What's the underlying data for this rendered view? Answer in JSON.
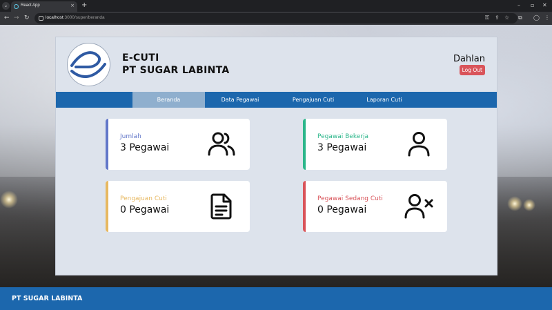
{
  "browser": {
    "tab_title": "React App",
    "url_host": "localhost",
    "url_path": ":3000/super/beranda",
    "menu_glyph": "⌄",
    "tab_close_glyph": "×",
    "new_tab_glyph": "+",
    "minimize_glyph": "–",
    "maximize_glyph": "▫",
    "close_glyph": "✕",
    "back_glyph": "←",
    "forward_glyph": "→",
    "reload_glyph": "↻",
    "key_glyph": "⚿",
    "share_glyph": "⇪",
    "star_glyph": "☆",
    "extensions_glyph": "⧉",
    "profile_glyph": "◯",
    "more_glyph": "⋮"
  },
  "header": {
    "brand_line_1": "E-CUTI",
    "brand_line_2": "PT SUGAR LABINTA",
    "user_name": "Dahlan",
    "logout_label": "Log Out"
  },
  "nav": {
    "items": [
      {
        "label": "Beranda"
      },
      {
        "label": "Data Pegawai"
      },
      {
        "label": "Pengajuan Cuti"
      },
      {
        "label": "Laporan Cuti"
      }
    ],
    "active_index": 0
  },
  "stats": [
    {
      "label": "Jumlah",
      "value": "3 Pegawai",
      "color": "#6277c9",
      "icon": "users-icon"
    },
    {
      "label": "Pegawai Bekerja",
      "value": "3 Pegawai",
      "color": "#2bb68a",
      "icon": "user-icon"
    },
    {
      "label": "Pengajuan Cuti",
      "value": "0 Pegawai",
      "color": "#e7b860",
      "icon": "document-icon"
    },
    {
      "label": "Pegawai Sedang Cuti",
      "value": "0 Pegawai",
      "color": "#d9545a",
      "icon": "user-x-icon"
    }
  ],
  "footer": {
    "text": "PT SUGAR LABINTA"
  },
  "colors": {
    "primary": "#1c67ad",
    "active_nav": "#8fafce",
    "logout": "#d9545a",
    "card_bg": "#dde3ec"
  }
}
